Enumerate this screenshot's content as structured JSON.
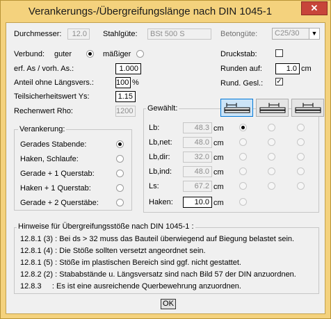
{
  "window": {
    "title": "Verankerungs-/Übergreifungslänge nach DIN 1045-1",
    "close_glyph": "✕"
  },
  "top": {
    "durchmesser_label": "Durchmesser:",
    "durchmesser_value": "12.0",
    "stahlguete_label": "Stahlgüte:",
    "stahlguete_value": "BSt 500 S",
    "betonguete_label": "Betongüte:",
    "betonguete_value": "C25/30",
    "betonguete_arrow": "▼"
  },
  "left": {
    "verbund_label": "Verbund:",
    "verbund_guter": "guter",
    "verbund_maessiger": "mäßiger",
    "verbund_selected": "guter",
    "erf_label": "erf. As / vorh. As.:",
    "erf_value": "1.000",
    "anteil_label": "Anteil ohne Längsvers.:",
    "anteil_value": "100",
    "anteil_unit": "%",
    "teilsicher_label": "Teilsicherheitswert Ys:",
    "teilsicher_value": "1.15",
    "rechenwert_label": "Rechenwert Rho:",
    "rechenwert_value": "1200"
  },
  "right": {
    "druckstab_label": "Druckstab:",
    "druckstab_checked": false,
    "runden_label": "Runden auf:",
    "runden_value": "1.0",
    "runden_unit": "cm",
    "rund_gesl_label": "Rund. Gesl.:",
    "rund_gesl_checked": true,
    "check_glyph": "✓"
  },
  "verankerung": {
    "title": "Verankerung:",
    "options": [
      {
        "label": "Gerades Stabende:",
        "selected": true
      },
      {
        "label": "Haken, Schlaufe:",
        "selected": false
      },
      {
        "label": "Gerade + 1 Querstab:",
        "selected": false
      },
      {
        "label": "Haken + 1 Querstab:",
        "selected": false
      },
      {
        "label": "Gerade + 2 Querstäbe:",
        "selected": false
      }
    ]
  },
  "gewaehlt": {
    "title": "Gewählt:",
    "icons": [
      "stab-icon-1",
      "stab-icon-2",
      "stab-icon-3"
    ],
    "rows": [
      {
        "label": "Lb:",
        "value": "48.3",
        "unit": "cm",
        "selected_col": 0
      },
      {
        "label": "Lb,net:",
        "value": "48.0",
        "unit": "cm",
        "selected_col": -1
      },
      {
        "label": "Lb,dir:",
        "value": "32.0",
        "unit": "cm",
        "selected_col": -1
      },
      {
        "label": "Lb,ind:",
        "value": "48.0",
        "unit": "cm",
        "selected_col": -1
      },
      {
        "label": "Ls:",
        "value": "67.2",
        "unit": "cm",
        "selected_col": -1
      }
    ],
    "haken_label": "Haken:",
    "haken_value": "10.0",
    "haken_unit": "cm"
  },
  "hinweise": {
    "title": "Hinweise für Übergreifungsstöße nach DIN 1045-1 :",
    "lines": [
      "12.8.1 (3) : Bei ds > 32 muss das Bauteil überwiegend auf Biegung belastet sein.",
      "12.8.1 (4) : Die Stöße sollten versetzt angeordnet sein.",
      "12.8.1 (5) : Stöße im plastischen Bereich sind ggf. nicht gestattet.",
      "12.8.2 (2) : Stababstände u. Längsversatz sind nach Bild 57 der DIN anzuordnen.",
      "12.8.3     : Es ist eine ausreichende Querbewehrung anzuordnen."
    ]
  },
  "ok_label": "OK"
}
